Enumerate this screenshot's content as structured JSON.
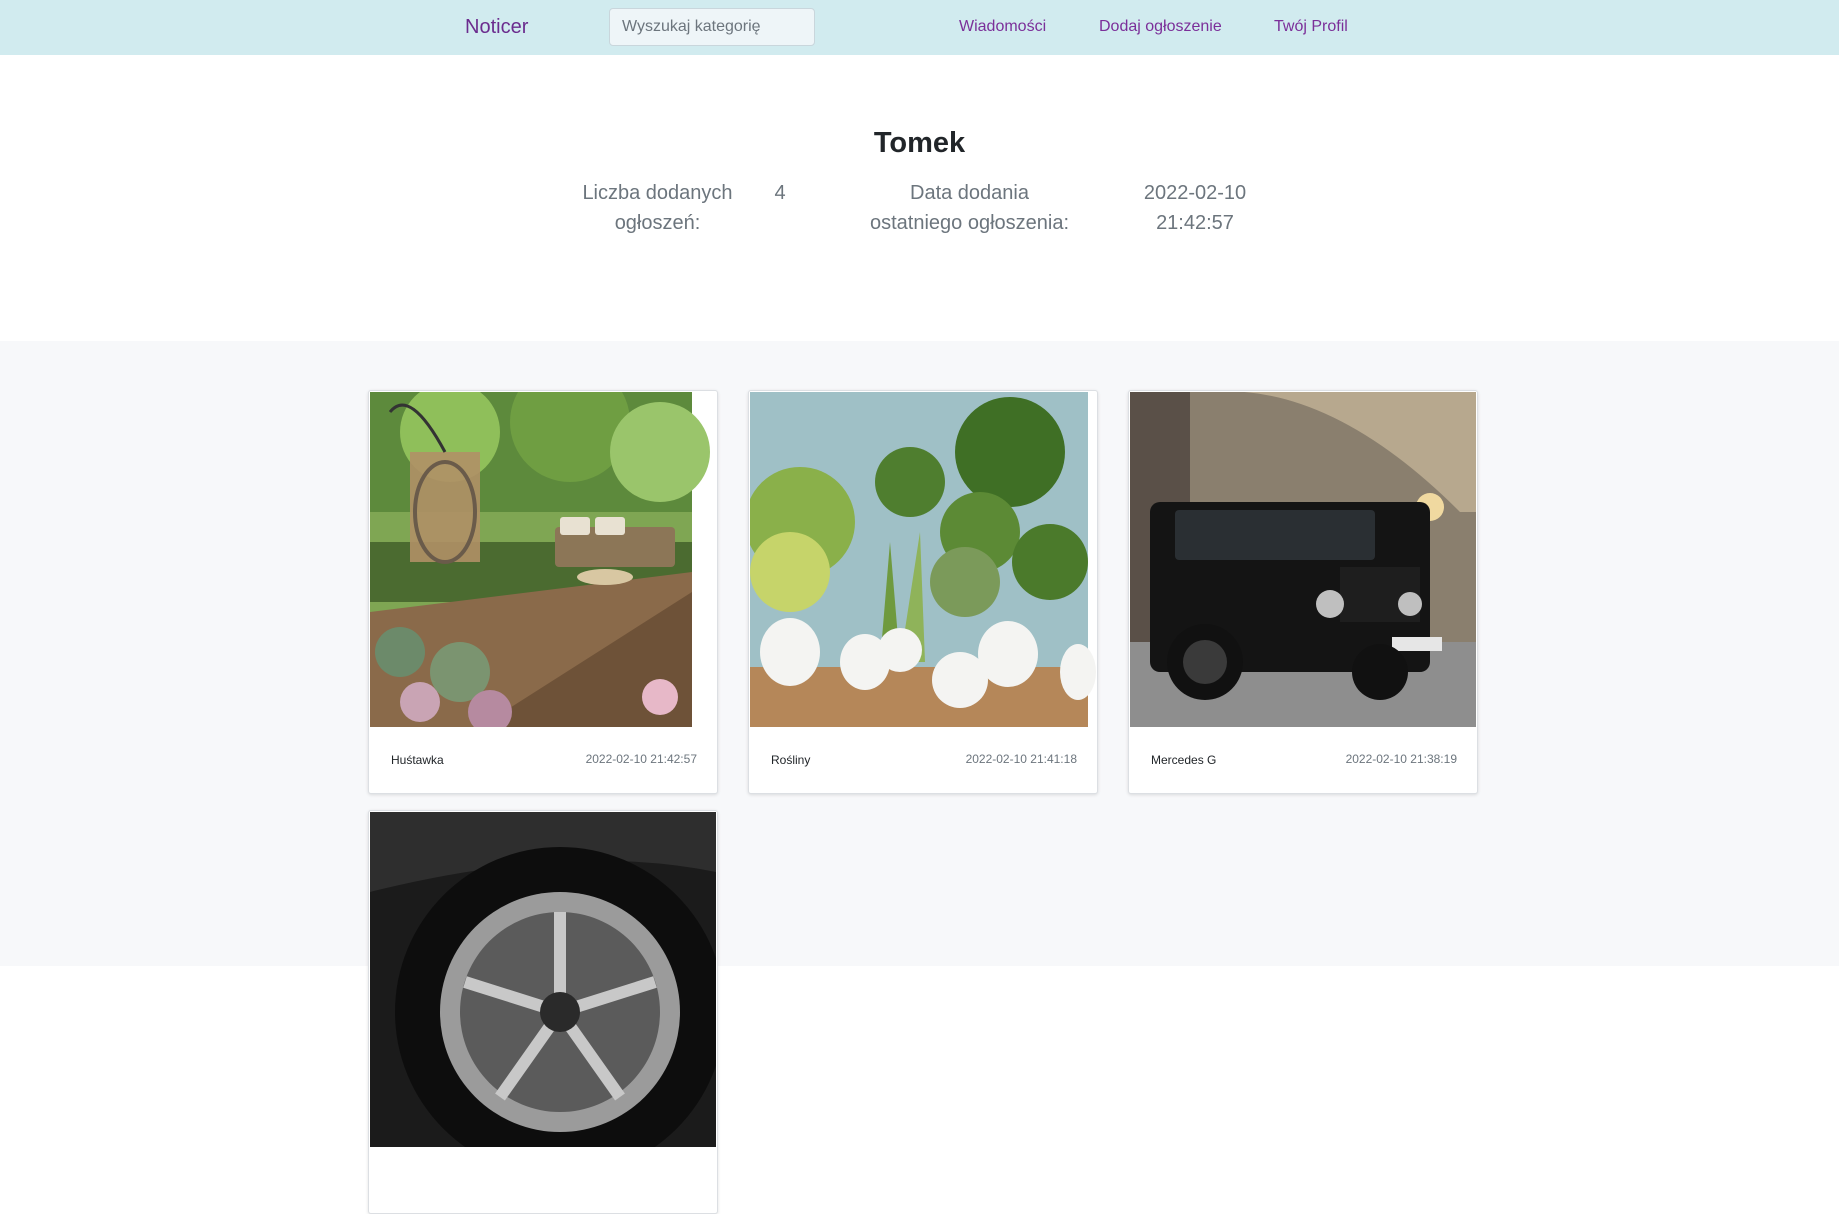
{
  "navbar": {
    "brand": "Noticer",
    "search_placeholder": "Wyszukaj kategorię",
    "links": {
      "messages": "Wiadomości",
      "add_listing": "Dodaj ogłoszenie",
      "profile": "Twój Profil"
    }
  },
  "profile": {
    "name": "Tomek",
    "count_label": "Liczba dodanych ogłoszeń:",
    "count_value": "4",
    "last_date_label": "Data dodania ostatniego ogłoszenia:",
    "last_date_value": "2022-02-10 21:42:57"
  },
  "listings": [
    {
      "title": "Huśtawka",
      "date": "2022-02-10 21:42:57",
      "image": "garden-swing-photo"
    },
    {
      "title": "Rośliny",
      "date": "2022-02-10 21:41:18",
      "image": "potted-plants-photo"
    },
    {
      "title": "Mercedes G",
      "date": "2022-02-10 21:38:19",
      "image": "black-suv-photo"
    },
    {
      "title": "",
      "date": "",
      "image": "car-wheel-photo"
    }
  ],
  "colors": {
    "navbar_bg": "#d1ebef",
    "link": "#7b2f99",
    "section_bg": "#f7f8fa"
  }
}
